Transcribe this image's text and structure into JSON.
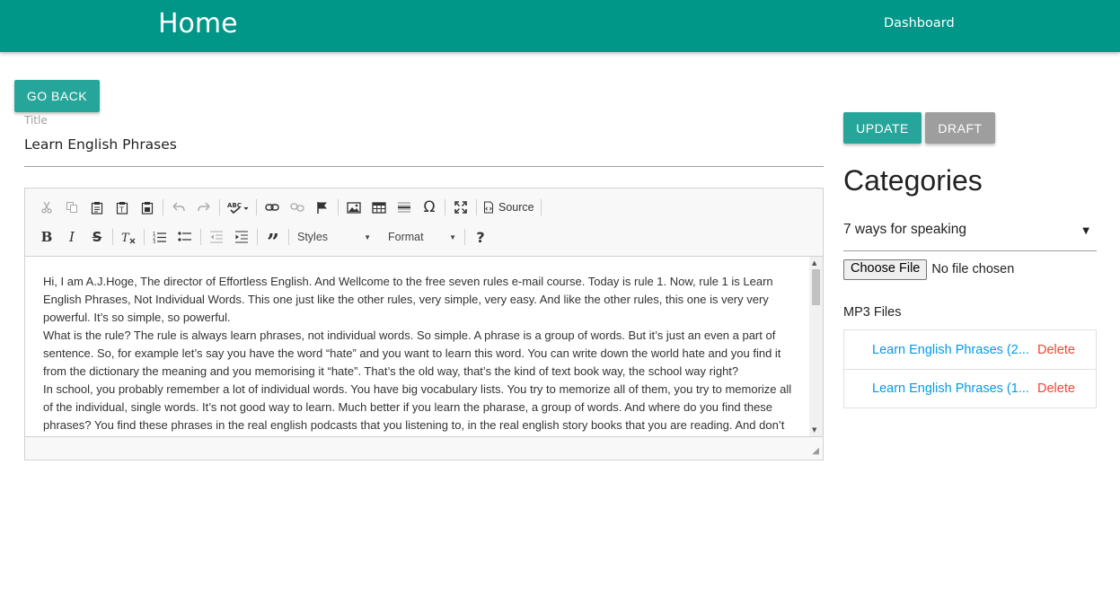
{
  "navbar": {
    "brand": "Home",
    "link": "Dashboard"
  },
  "actions": {
    "go_back": "GO BACK",
    "update": "UPDATE",
    "draft": "DRAFT"
  },
  "title_field": {
    "label": "Title",
    "value": "Learn English Phrases"
  },
  "editor": {
    "toolbar_row1": [
      "cut-icon",
      "copy-icon",
      "paste-icon",
      "paste-text-icon",
      "paste-word-icon",
      "undo-icon",
      "redo-icon",
      "spellcheck-icon",
      "link-icon",
      "unlink-icon",
      "anchor-icon",
      "image-icon",
      "table-icon",
      "horizontal-line-icon",
      "special-char-icon",
      "maximize-icon",
      "source-icon"
    ],
    "source_label": "Source",
    "styles_label": "Styles",
    "format_label": "Format",
    "paragraphs": [
      "Hi, I am A.J.Hoge, The director of Effortless English. And Wellcome to the free seven rules e-mail course. Today is rule 1. Now, rule 1 is Learn English Phrases, Not Individual Words. This one just like the other rules, very simple, very easy. And like the other rules, this one is very very powerful. It’s so simple, so powerful.",
      "What is the rule? The rule is always learn phrases, not individual words. So simple. A phrase is a group of words. But it’s just an even a part of sentence. So, for example let’s say you have the word “hate” and you want to learn this word. You can write down the world hate and you find it from the dictionary the meaning and you memorising it “hate”. That’s the old way, that’s the kind of text book way, the school way right?",
      "In school, you probably remember a lot of individual words. You have big vocabulary lists. You try to memorize all of them, you try to memorize all of the individual, single words. It’s not good way to learn. Much better if you learn the pharase, a group of words. And where do you find these phrases? You find these phrases in the real english podcasts that you listening to, in the real english story books that you are reading. And don’t"
    ]
  },
  "sidebar": {
    "categories_title": "Categories",
    "category_selected": "7 ways for speaking",
    "file_button": "Choose File",
    "file_status": "No file chosen",
    "mp3_label": "MP3 Files",
    "mp3_files": [
      {
        "name": "Learn English Phrases (2...",
        "delete": "Delete"
      },
      {
        "name": "Learn English Phrases (1...",
        "delete": "Delete"
      }
    ]
  },
  "colors": {
    "primary": "#009688",
    "button": "#26a69a",
    "draft": "#9e9e9e",
    "link": "#039be5",
    "delete": "#f44336"
  }
}
